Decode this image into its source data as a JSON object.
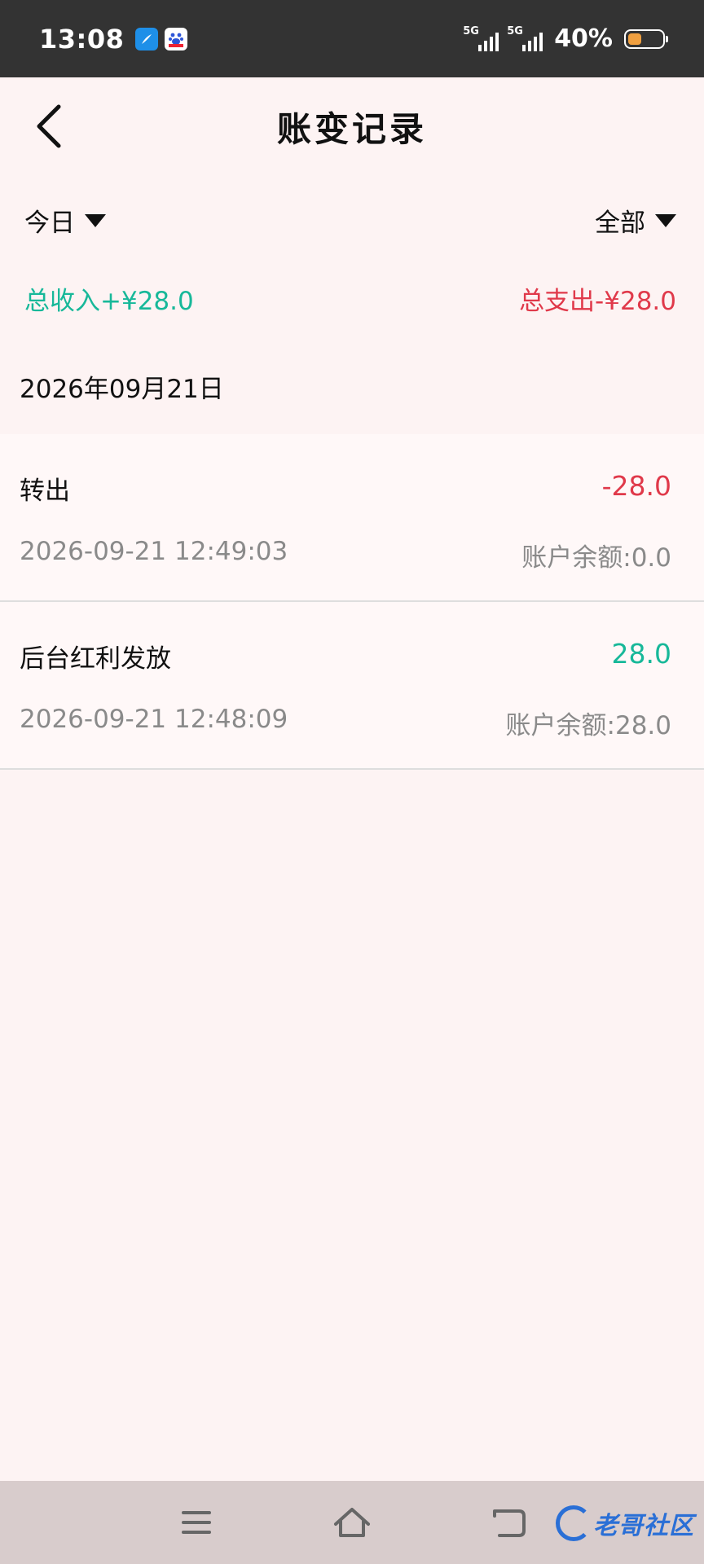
{
  "status_bar": {
    "time": "13:08",
    "signal1_label": "5G",
    "signal2_label": "5G",
    "battery": "40%",
    "battery_level": 0.4
  },
  "header": {
    "title": "账变记录"
  },
  "filters": {
    "date_filter": "今日",
    "type_filter": "全部"
  },
  "totals": {
    "income": "总收入+¥28.0",
    "expense": "总支出-¥28.0"
  },
  "date_group": "2026年09月21日",
  "records": [
    {
      "title": "转出",
      "amount": "-28.0",
      "time": "2026-09-21 12:49:03",
      "balance": "账户余额:0.0",
      "amount_color": "#e0394a"
    },
    {
      "title": "后台红利发放",
      "amount": "28.0",
      "time": "2026-09-21 12:48:09",
      "balance": "账户余额:28.0",
      "amount_color": "#17b899"
    }
  ],
  "watermark": "老哥社区",
  "colors": {
    "income": "#17b899",
    "expense": "#e0394a",
    "background": "#fdf3f3"
  },
  "icons": [
    "back-arrow-icon",
    "dropdown-triangle-icon",
    "menu-icon",
    "home-icon",
    "back-nav-icon"
  ]
}
